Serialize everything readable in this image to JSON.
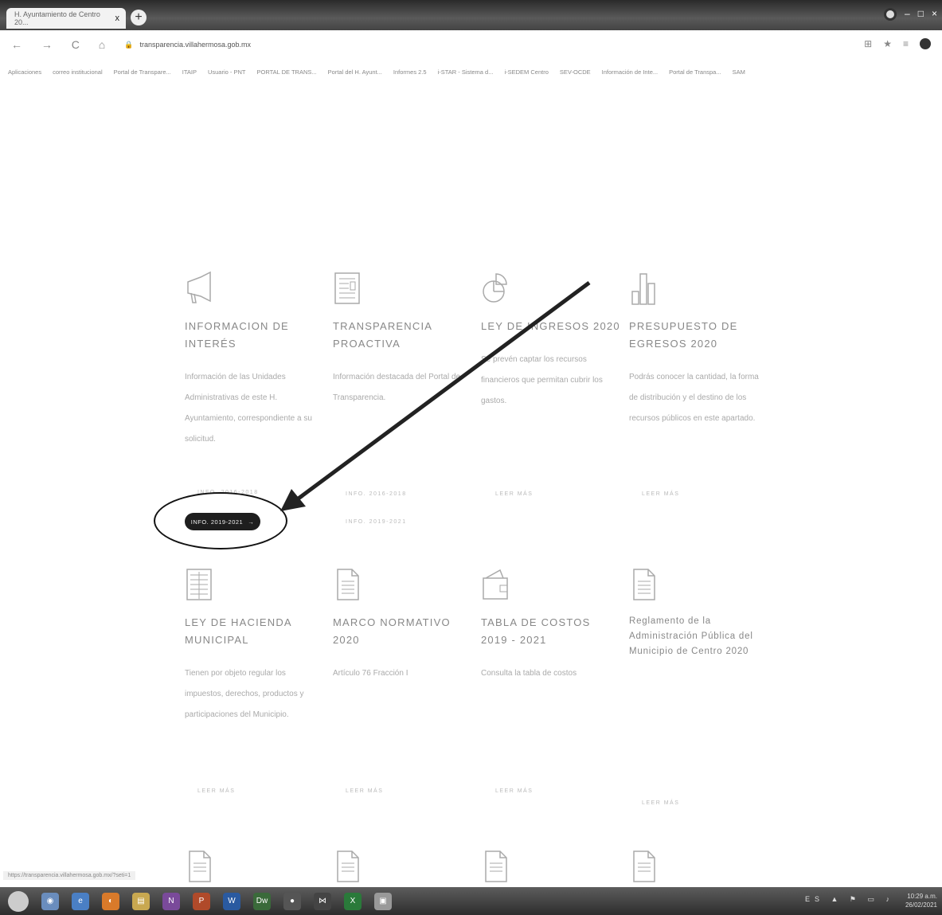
{
  "browser": {
    "tab_title": "H. Ayuntamiento de Centro 20...",
    "tab_close": "x",
    "new_tab": "+",
    "nav_buttons": "← → C ⌂",
    "url": "transparencia.villahermosa.gob.mx",
    "bookmarks": [
      "Aplicaciones",
      "correo institucional",
      "Portal de Transpare...",
      "ITAIP",
      "Usuario - PNT",
      "PORTAL DE TRANS...",
      "Portal del H. Ayunt...",
      "Informes 2.5",
      "i-STAR - Sistema d...",
      "i-SEDEM Centro",
      "SEV-OCDE",
      "Información de Inte...",
      "Portal de Transpa...",
      "SAM"
    ],
    "status_url": "https://transparencia.villahermosa.gob.mx/?seti=1"
  },
  "cards_row1": [
    {
      "icon": "megaphone-icon",
      "title": "INFORMACION DE INTERÉS",
      "desc": "Información de las Unidades Administrativas de este H. Ayuntamiento, correspondiente a su solicitud.",
      "more": "INFO. 2016-2018"
    },
    {
      "icon": "newspaper-icon",
      "title": "TRANSPARENCIA PROACTIVA",
      "desc": "Información destacada del Portal de Transparencia.",
      "more": "INFO. 2016-2018"
    },
    {
      "icon": "pie-chart-icon",
      "title": "LEY DE INGRESOS 2020",
      "desc": "Se prevén captar los recursos financieros que permitan cubrir los gastos.",
      "more": "LEER MÁS"
    },
    {
      "icon": "bar-chart-icon",
      "title": "PRESUPUESTO DE EGRESOS 2020",
      "desc": "Podrás conocer la cantidad, la forma de distribución y el destino de los recursos públicos en este apartado.",
      "more": "LEER MÁS"
    }
  ],
  "second_links": {
    "col1_btn": "INFO. 2019-2021",
    "col2": "INFO. 2019-2021"
  },
  "cards_row2": [
    {
      "icon": "document-icon",
      "title": "LEY DE HACIENDA MUNICIPAL",
      "desc": "Tienen por objeto regular los impuestos, derechos, productos y participaciones del Municipio.",
      "more": "LEER MÁS"
    },
    {
      "icon": "document-icon",
      "title": "MARCO NORMATIVO 2020",
      "desc": "Artículo 76 Fracción I",
      "more": "LEER MÁS"
    },
    {
      "icon": "wallet-icon",
      "title": "TABLA DE COSTOS 2019 - 2021",
      "desc": "Consulta la tabla de costos",
      "more": "LEER MÁS"
    },
    {
      "icon": "document-icon",
      "title": "Reglamento de la Administración Pública del Municipio de Centro 2020",
      "desc": "",
      "more": "LEER MÁS"
    }
  ],
  "taskbar": {
    "time": "10:29 a.m.",
    "date": "26/02/2021",
    "lang": "ES"
  }
}
